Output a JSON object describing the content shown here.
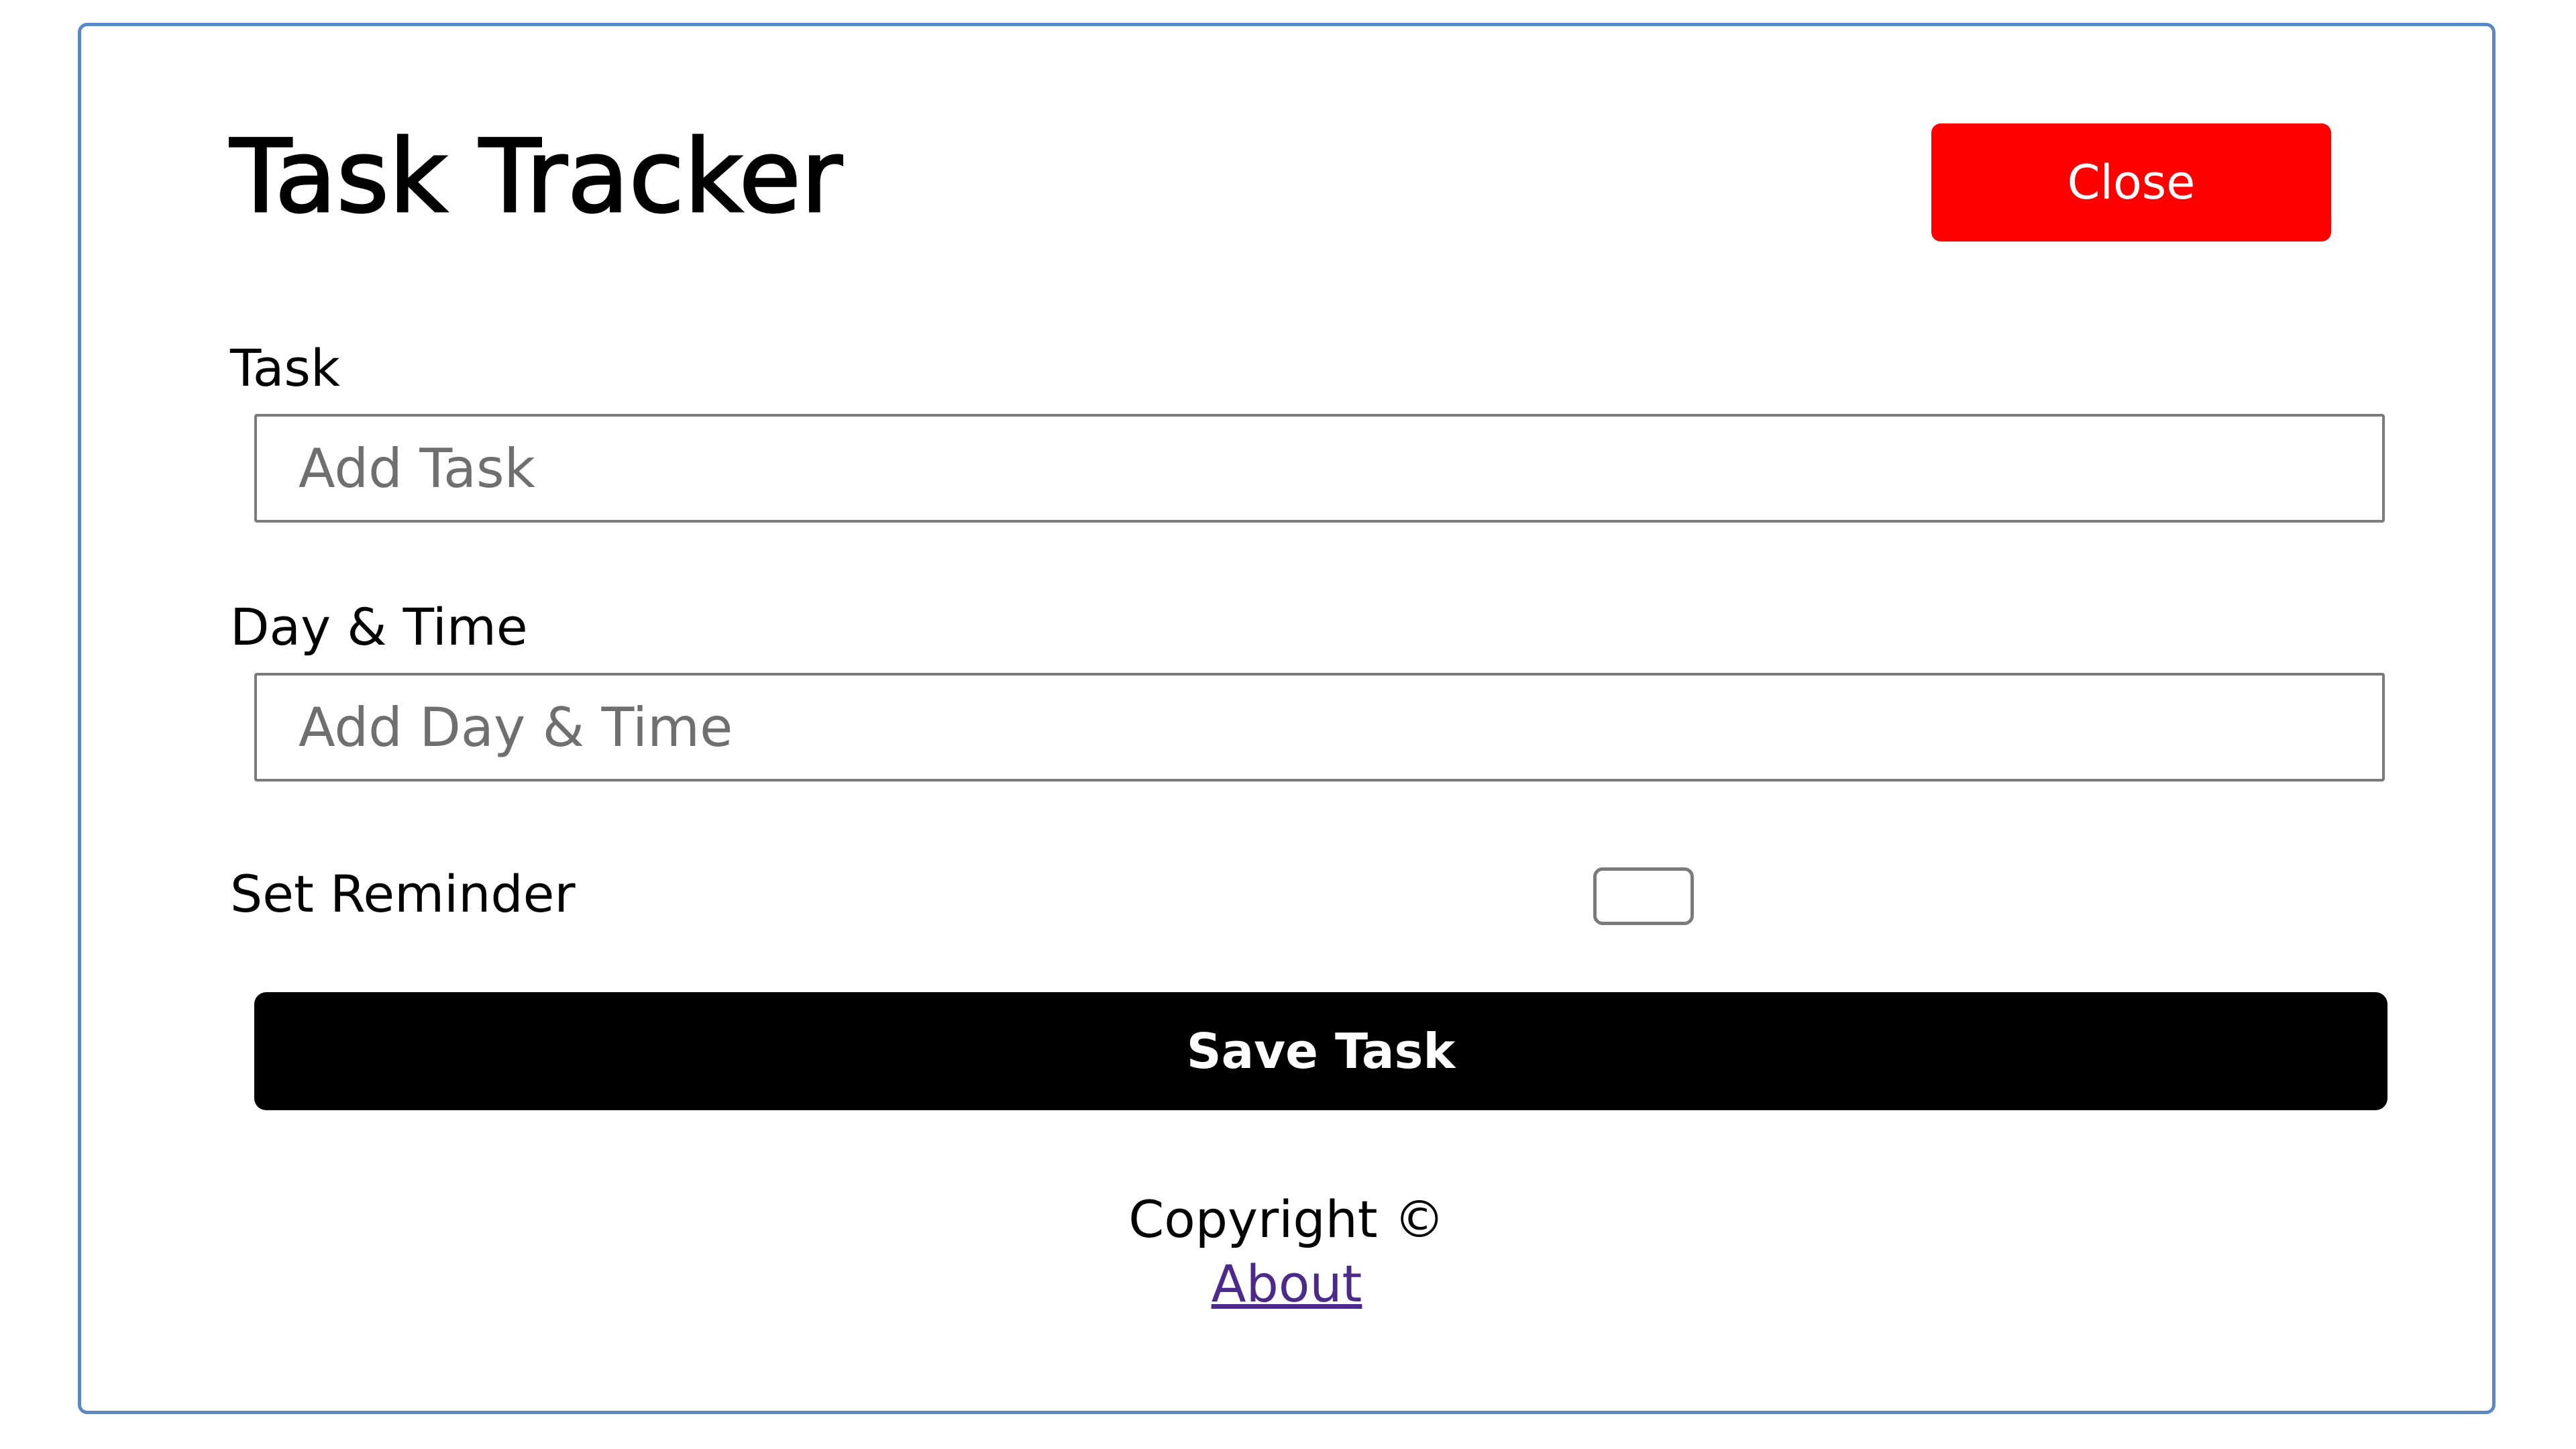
{
  "app": {
    "title": "Task Tracker",
    "close_label": "Close"
  },
  "form": {
    "task": {
      "label": "Task",
      "placeholder": "Add Task",
      "value": ""
    },
    "day_time": {
      "label": "Day & Time",
      "placeholder": "Add Day & Time",
      "value": ""
    },
    "reminder": {
      "label": "Set Reminder",
      "checked": false
    },
    "save_label": "Save Task"
  },
  "footer": {
    "copyright": "Copyright ©",
    "about_label": "About"
  },
  "colors": {
    "close_button": "#ff0000",
    "save_button": "#000000",
    "card_border": "#5a88c6",
    "link": "#4b2a8c"
  }
}
